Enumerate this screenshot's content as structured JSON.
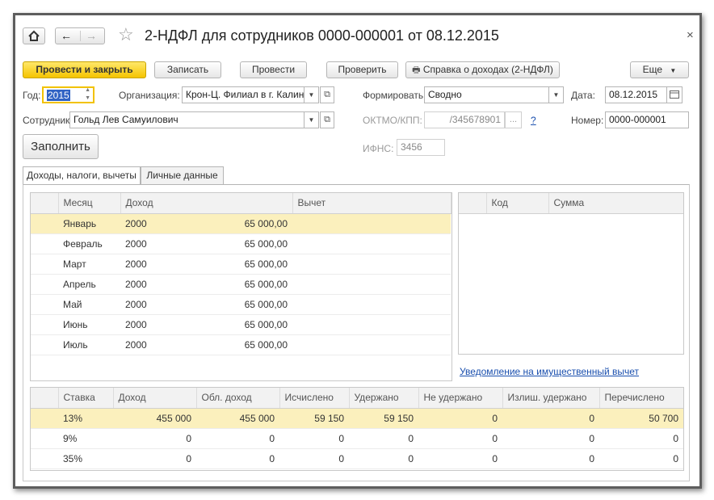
{
  "window": {
    "title": "2-НДФЛ для сотрудников 0000-000001 от 08.12.2015",
    "close": "×"
  },
  "toolbar": {
    "post_and_close": "Провести и закрыть",
    "save": "Записать",
    "post": "Провести",
    "check": "Проверить",
    "income_report": "Справка о доходах (2-НДФЛ)",
    "more": "Еще"
  },
  "form": {
    "year_label": "Год:",
    "year_value": "2015",
    "org_label": "Организация:",
    "org_value": "Крон-Ц. Филиал в г. Калинин",
    "form_label": "Формировать:",
    "form_value": "Сводно",
    "date_label": "Дата:",
    "date_value": "08.12.2015",
    "employee_label": "Сотрудник:",
    "employee_value": "Гольд Лев Самуилович",
    "oktmo_label": "ОКТМО/КПП:",
    "oktmo_value": "/345678901",
    "oktmo_help": "?",
    "number_label": "Номер:",
    "number_value": "0000-000001",
    "ifns_label": "ИФНС:",
    "ifns_value": "3456",
    "fill_button": "Заполнить"
  },
  "tabs": [
    {
      "label": "Доходы, налоги, вычеты"
    },
    {
      "label": "Личные данные"
    }
  ],
  "income_table": {
    "headers": [
      "Месяц",
      "Доход",
      "Вычет"
    ],
    "rows": [
      {
        "month": "Январь",
        "code": "2000",
        "amount": "65 000,00"
      },
      {
        "month": "Февраль",
        "code": "2000",
        "amount": "65 000,00"
      },
      {
        "month": "Март",
        "code": "2000",
        "amount": "65 000,00"
      },
      {
        "month": "Апрель",
        "code": "2000",
        "amount": "65 000,00"
      },
      {
        "month": "Май",
        "code": "2000",
        "amount": "65 000,00"
      },
      {
        "month": "Июнь",
        "code": "2000",
        "amount": "65 000,00"
      },
      {
        "month": "Июль",
        "code": "2000",
        "amount": "65 000,00"
      }
    ]
  },
  "deduction_table": {
    "headers": [
      "Код",
      "Сумма"
    ]
  },
  "property_link": "Уведомление на имущественный вычет",
  "summary_table": {
    "headers": [
      "Ставка",
      "Доход",
      "Обл. доход",
      "Исчислено",
      "Удержано",
      "Не удержано",
      "Излиш. удержано",
      "Перечислено"
    ],
    "rows": [
      [
        "13%",
        "455 000",
        "455 000",
        "59 150",
        "59 150",
        "0",
        "0",
        "50 700"
      ],
      [
        "9%",
        "0",
        "0",
        "0",
        "0",
        "0",
        "0",
        "0"
      ],
      [
        "35%",
        "0",
        "0",
        "0",
        "0",
        "0",
        "0",
        "0"
      ]
    ]
  }
}
